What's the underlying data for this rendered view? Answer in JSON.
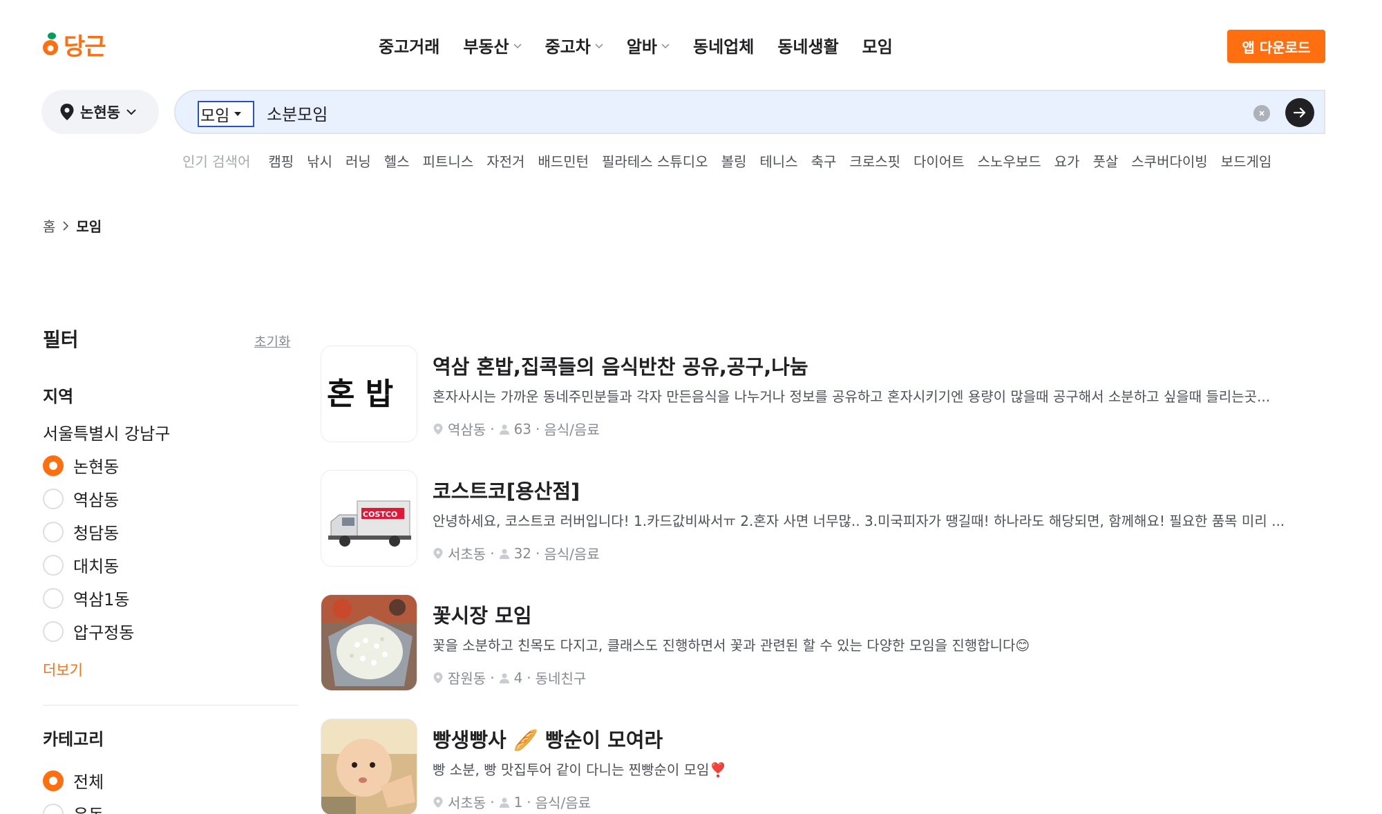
{
  "header": {
    "logo_text": "당근",
    "nav": [
      {
        "label": "중고거래",
        "has_dropdown": false
      },
      {
        "label": "부동산",
        "has_dropdown": true
      },
      {
        "label": "중고차",
        "has_dropdown": true
      },
      {
        "label": "알바",
        "has_dropdown": true
      },
      {
        "label": "동네업체",
        "has_dropdown": false
      },
      {
        "label": "동네생활",
        "has_dropdown": false
      },
      {
        "label": "모임",
        "has_dropdown": false
      }
    ],
    "app_download": "앱 다운로드"
  },
  "search": {
    "location": "논현동",
    "category": "모임",
    "query": "소분모임"
  },
  "popular": {
    "label": "인기 검색어",
    "keywords": [
      "캠핑",
      "낚시",
      "러닝",
      "헬스",
      "피트니스",
      "자전거",
      "배드민턴",
      "필라테스 스튜디오",
      "볼링",
      "테니스",
      "축구",
      "크로스핏",
      "다이어트",
      "스노우보드",
      "요가",
      "풋살",
      "스쿠버다이빙",
      "보드게임"
    ]
  },
  "breadcrumb": {
    "home": "홈",
    "current": "모임"
  },
  "filter": {
    "title": "필터",
    "reset": "초기화",
    "region_title": "지역",
    "region_name": "서울특별시 강남구",
    "regions": [
      {
        "label": "논현동",
        "selected": true
      },
      {
        "label": "역삼동",
        "selected": false
      },
      {
        "label": "청담동",
        "selected": false
      },
      {
        "label": "대치동",
        "selected": false
      },
      {
        "label": "역삼1동",
        "selected": false
      },
      {
        "label": "압구정동",
        "selected": false
      }
    ],
    "more": "더보기",
    "category_title": "카테고리",
    "categories": [
      {
        "label": "전체",
        "selected": true
      },
      {
        "label": "운동",
        "selected": false
      }
    ]
  },
  "groups": [
    {
      "title": "역삼 혼밥,집콕들의 음식반찬 공유,공구,나눔",
      "description": "혼자사시는 가까운 동네주민분들과 각자 만든음식을 나누거나 정보를 공유하고 혼자시키기엔 용량이 많을때 공구해서 소분하고 싶을때 들리는곳...",
      "location": "역삼동",
      "members": "63",
      "category": "음식/음료",
      "thumb_text": "혼 밥"
    },
    {
      "title": "코스트코[용산점]",
      "description": "안녕하세요, 코스트코 러버입니다! 1.카드값비싸서ㅠ 2.혼자 사면 너무많.. 3.미국피자가 땡길때! 하나라도 해당되면, 함께해요! 필요한 품목 미리 ...",
      "location": "서초동",
      "members": "32",
      "category": "음식/음료",
      "thumb_text": "COSTCO"
    },
    {
      "title": "꽃시장 모임",
      "description": "꽃을 소분하고 친목도 다지고, 클래스도 진행하면서 꽃과 관련된 할 수 있는 다양한 모임을 진행합니다😊",
      "location": "잠원동",
      "members": "4",
      "category": "동네친구",
      "thumb_text": ""
    },
    {
      "title": "빵생빵사 🥖 빵순이 모여라",
      "description": "빵 소분, 빵 맛집투어 같이 다니는 찐빵순이 모임❣️",
      "location": "서초동",
      "members": "1",
      "category": "음식/음료",
      "thumb_text": ""
    }
  ],
  "colors": {
    "brand": "#ff6f0f",
    "search_bg": "#e9f0fe",
    "text": "#212124",
    "muted": "#868b94"
  }
}
